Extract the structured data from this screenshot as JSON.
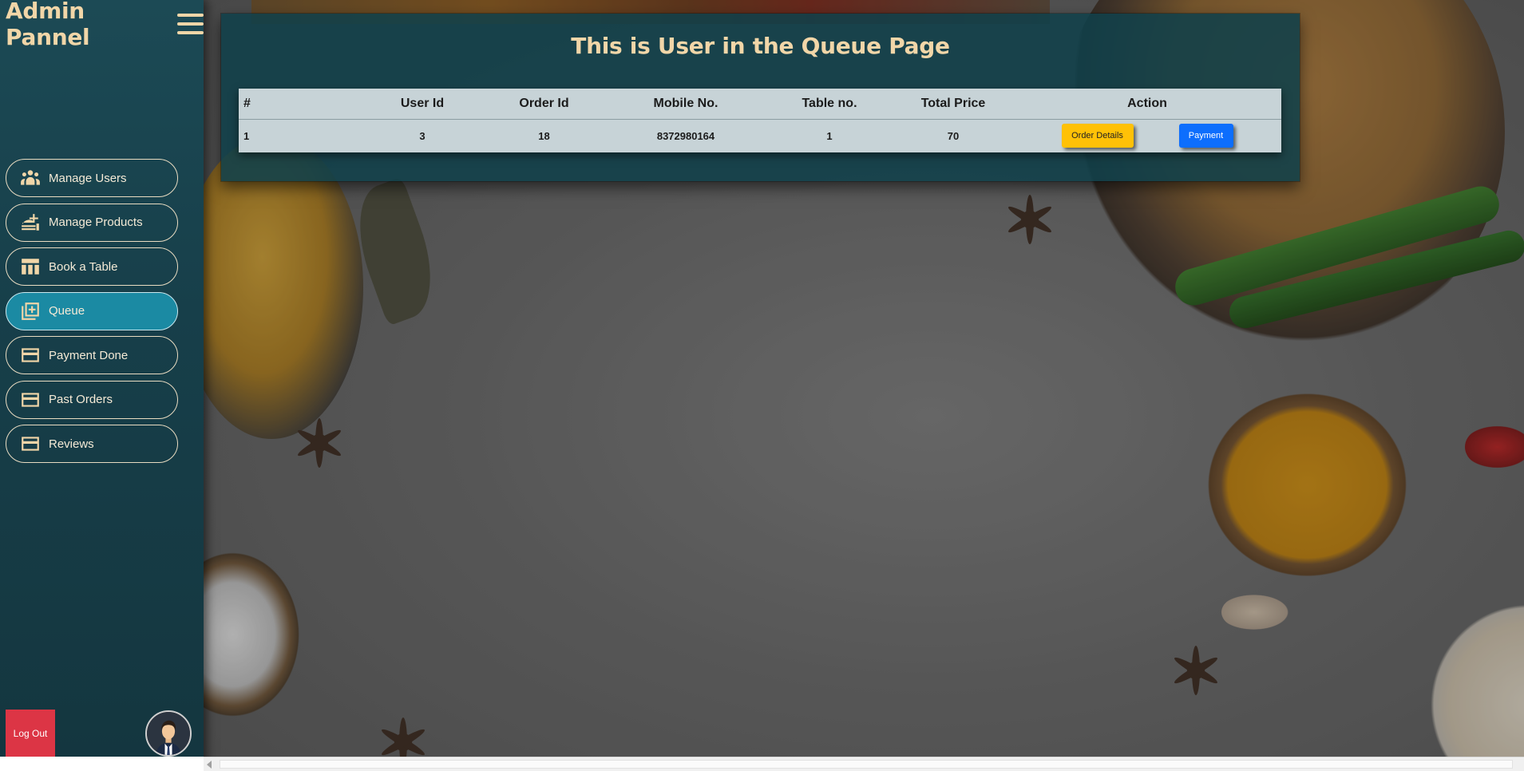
{
  "sidebar": {
    "title": "Admin Pannel",
    "items": [
      {
        "label": "Manage Users",
        "icon": "users-icon",
        "active": false
      },
      {
        "label": "Manage Products",
        "icon": "food-serving-icon",
        "active": false
      },
      {
        "label": "Book a Table",
        "icon": "table-icon",
        "active": false
      },
      {
        "label": "Queue",
        "icon": "add-to-queue-icon",
        "active": true
      },
      {
        "label": "Payment Done",
        "icon": "card-icon",
        "active": false
      },
      {
        "label": "Past Orders",
        "icon": "card-icon",
        "active": false
      },
      {
        "label": "Reviews",
        "icon": "card-icon",
        "active": false
      }
    ],
    "logout_label": "Log Out"
  },
  "main": {
    "title": "This is User in the Queue Page",
    "table": {
      "headers": [
        "#",
        "User Id",
        "Order Id",
        "Mobile No.",
        "Table no.",
        "Total Price",
        "Action"
      ],
      "rows": [
        {
          "num": "1",
          "user_id": "3",
          "order_id": "18",
          "mobile": "8372980164",
          "table_no": "1",
          "total_price": "70"
        }
      ],
      "actions": {
        "details_label": "Order Details",
        "payment_label": "Payment"
      }
    }
  },
  "colors": {
    "sidebar_bg": "#173f4a",
    "accent_text": "#f1d6a8",
    "active_item": "#1b8aa3",
    "logout_bg": "#dc3545",
    "details_btn": "#ffc107",
    "payment_btn": "#0d6efd"
  }
}
